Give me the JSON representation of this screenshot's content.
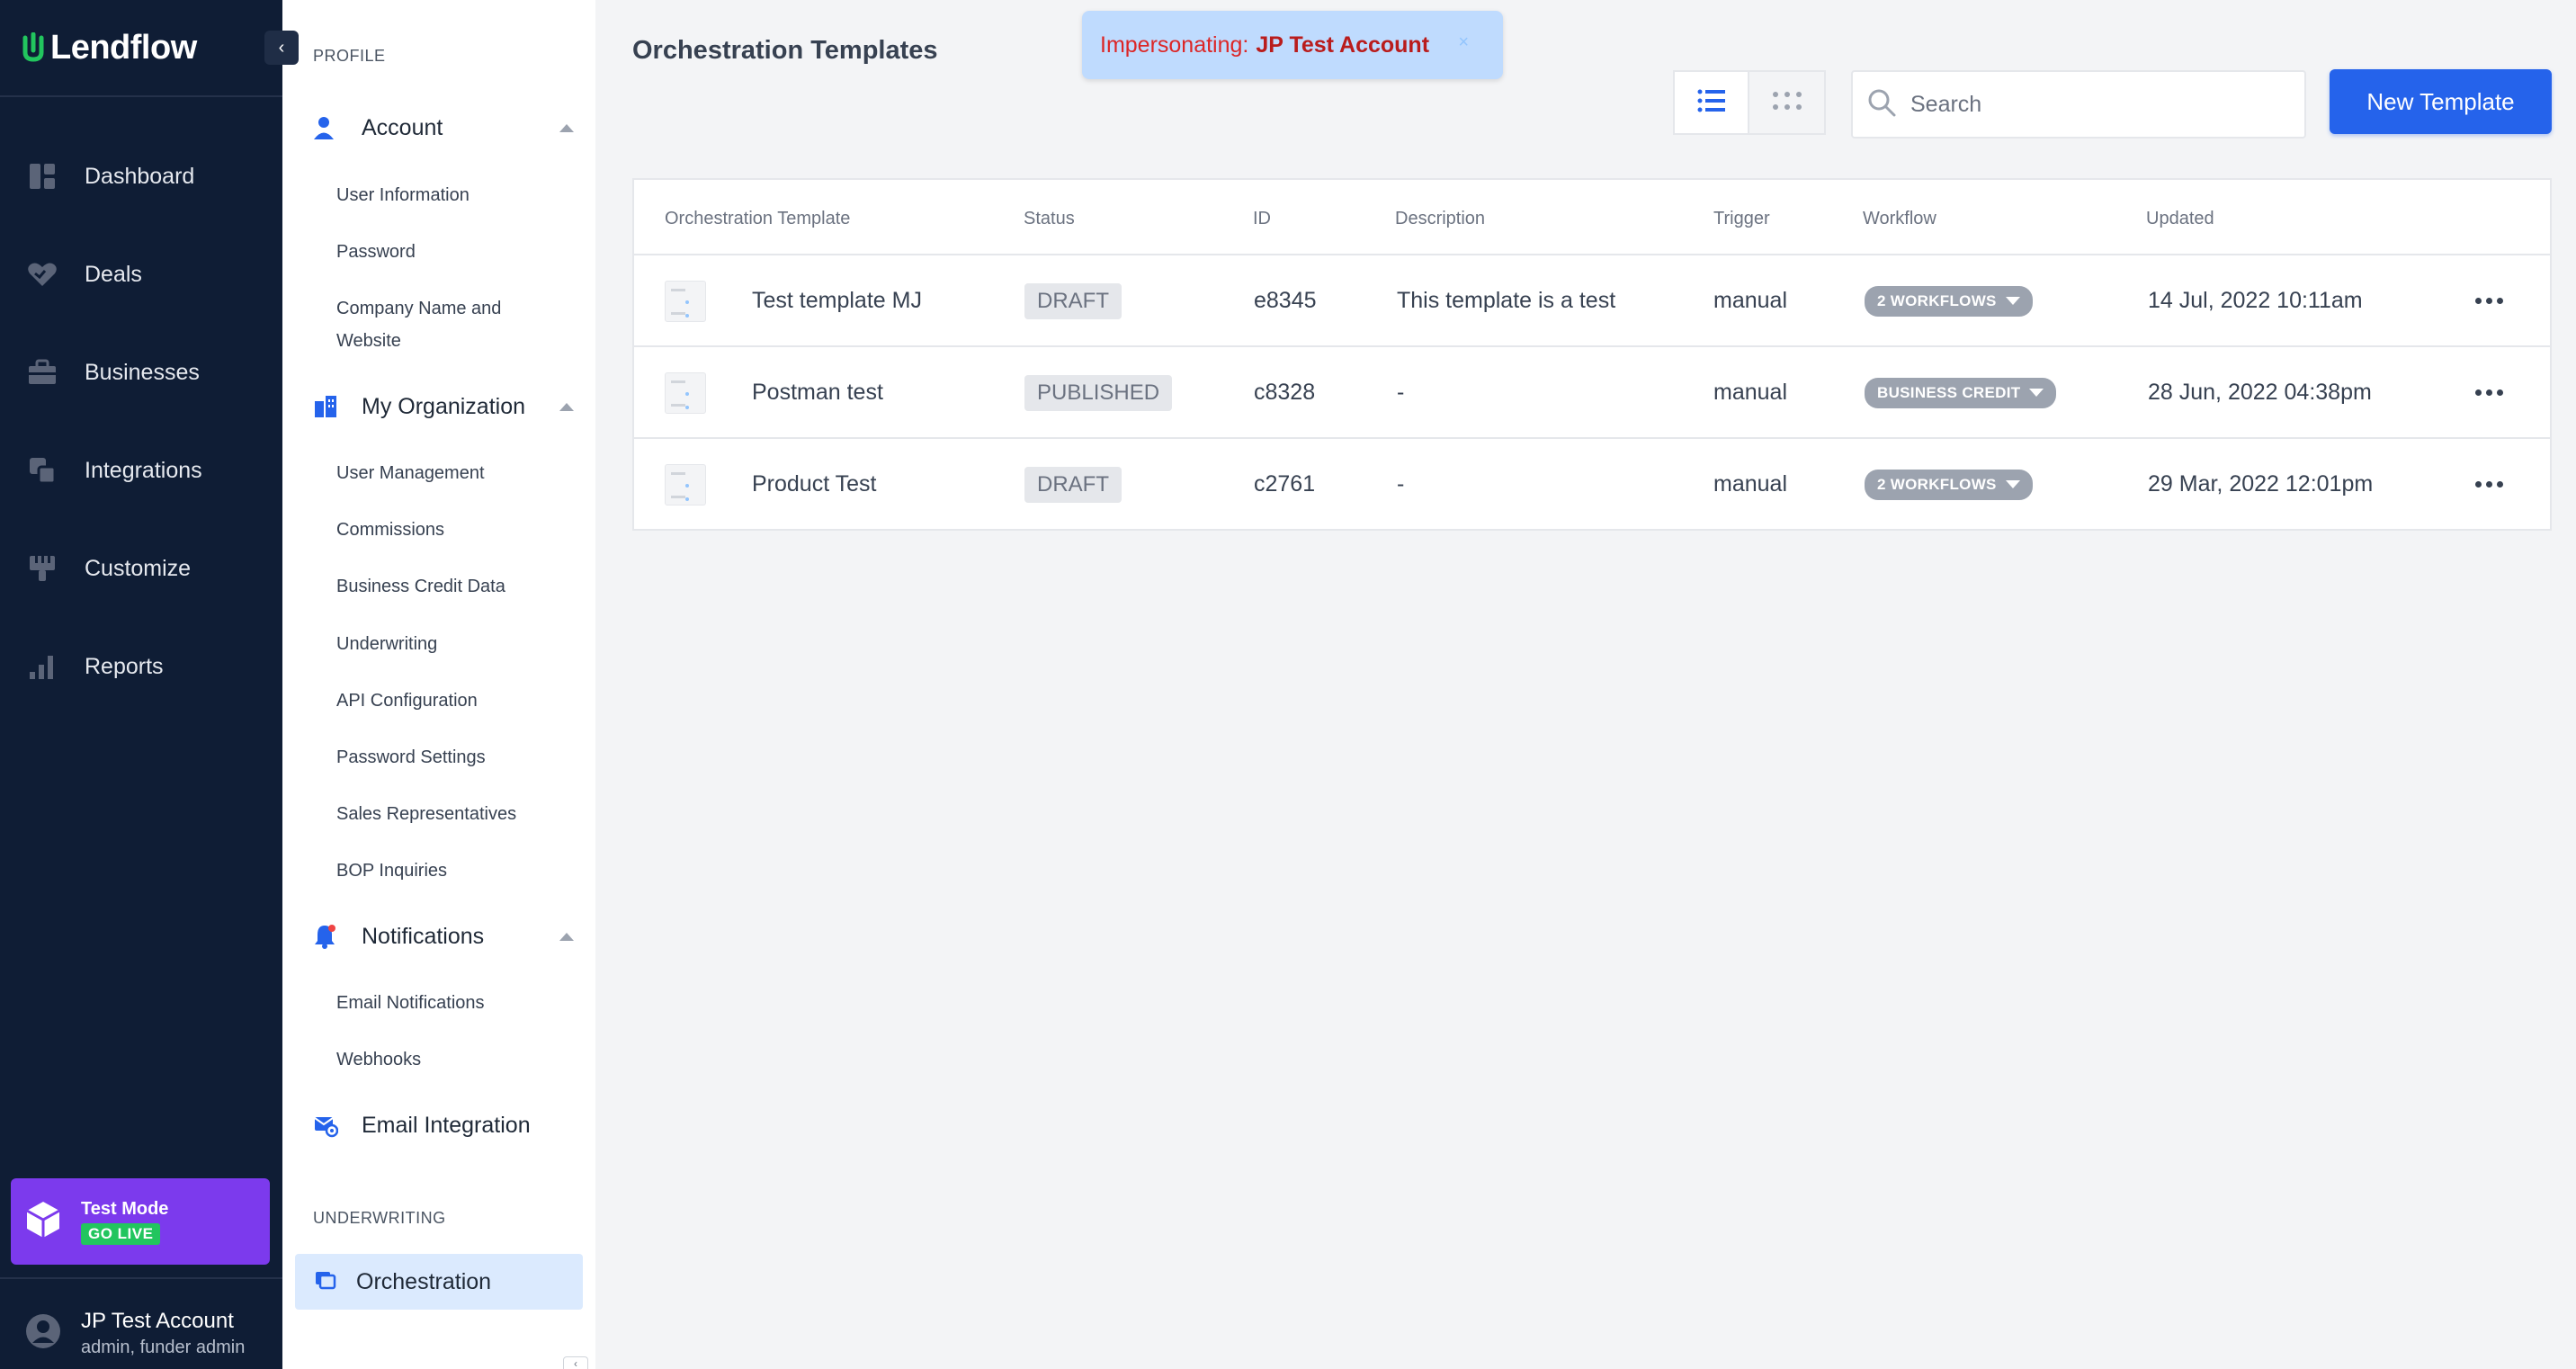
{
  "app": {
    "logo_text": "Lendflow",
    "colors": {
      "nav_bg": "#0f1d35",
      "accent": "#2563eb",
      "brand_green": "#22c55e",
      "test_mode": "#7c3aed",
      "impersonate_bg": "#bfdbfe",
      "impersonate_text": "#dc2626"
    }
  },
  "leftnav": {
    "items": [
      {
        "label": "Dashboard",
        "icon": "dashboard-icon"
      },
      {
        "label": "Deals",
        "icon": "deals-icon"
      },
      {
        "label": "Businesses",
        "icon": "briefcase-icon"
      },
      {
        "label": "Integrations",
        "icon": "integrations-icon"
      },
      {
        "label": "Customize",
        "icon": "brush-icon"
      },
      {
        "label": "Reports",
        "icon": "bar-chart-icon"
      }
    ],
    "test_mode": {
      "title": "Test Mode",
      "badge": "GO LIVE"
    },
    "user": {
      "name": "JP Test Account",
      "role": "admin, funder admin"
    }
  },
  "settings": {
    "profile_label": "PROFILE",
    "account": {
      "label": "Account",
      "items": [
        "User Information",
        "Password",
        "Company Name and Website"
      ]
    },
    "organization": {
      "label": "My Organization",
      "items": [
        "User Management",
        "Commissions",
        "Business Credit Data",
        "Underwriting",
        "API Configuration",
        "Password Settings",
        "Sales Representatives",
        "BOP Inquiries"
      ]
    },
    "notifications": {
      "label": "Notifications",
      "items": [
        "Email Notifications",
        "Webhooks"
      ]
    },
    "email_integration": {
      "label": "Email Integration"
    },
    "underwriting_label": "UNDERWRITING",
    "orchestration": {
      "label": "Orchestration"
    }
  },
  "main": {
    "title": "Orchestration Templates",
    "impersonation": {
      "prefix": "Impersonating:",
      "account": "JP Test Account",
      "close": "×"
    },
    "search": {
      "placeholder": "Search",
      "value": ""
    },
    "new_button": "New Template",
    "table": {
      "headers": [
        "Orchestration Template",
        "Status",
        "ID",
        "Description",
        "Trigger",
        "Workflow",
        "Updated"
      ],
      "rows": [
        {
          "name": "Test template MJ",
          "status": "DRAFT",
          "id": "e8345",
          "description": "This template is a test",
          "trigger": "manual",
          "workflow": "2 WORKFLOWS",
          "updated": "14 Jul, 2022 10:11am"
        },
        {
          "name": "Postman test",
          "status": "PUBLISHED",
          "id": "c8328",
          "description": "-",
          "trigger": "manual",
          "workflow": "BUSINESS CREDIT",
          "updated": "28 Jun, 2022 04:38pm"
        },
        {
          "name": "Product Test",
          "status": "DRAFT",
          "id": "c2761",
          "description": "-",
          "trigger": "manual",
          "workflow": "2 WORKFLOWS",
          "updated": "29 Mar, 2022 12:01pm"
        }
      ]
    }
  }
}
